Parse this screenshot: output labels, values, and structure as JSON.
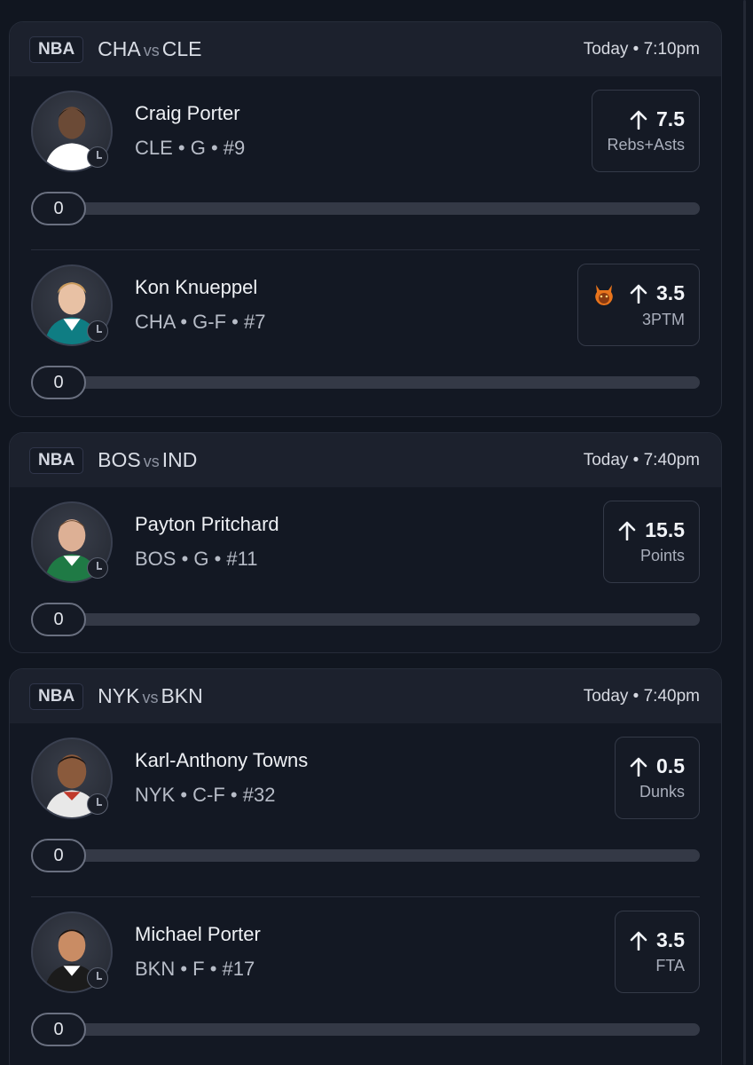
{
  "games": [
    {
      "league": "NBA",
      "home": "CHA",
      "vs": "vs",
      "away": "CLE",
      "time": "Today • 7:10pm",
      "players": [
        {
          "name": "Craig Porter",
          "meta": "CLE • G • #9",
          "line": "7.5",
          "stat": "Rebs+Asts",
          "progress": "0",
          "hot": false,
          "jersey": "#ffffff"
        },
        {
          "name": "Kon Knueppel",
          "meta": "CHA • G-F • #7",
          "line": "3.5",
          "stat": "3PTM",
          "progress": "0",
          "hot": true,
          "jersey": "#0f7d83"
        }
      ]
    },
    {
      "league": "NBA",
      "home": "BOS",
      "vs": "vs",
      "away": "IND",
      "time": "Today • 7:40pm",
      "players": [
        {
          "name": "Payton Pritchard",
          "meta": "BOS • G • #11",
          "line": "15.5",
          "stat": "Points",
          "progress": "0",
          "hot": false,
          "jersey": "#1f7a45"
        }
      ]
    },
    {
      "league": "NBA",
      "home": "NYK",
      "vs": "vs",
      "away": "BKN",
      "time": "Today • 7:40pm",
      "players": [
        {
          "name": "Karl-Anthony Towns",
          "meta": "NYK • C-F • #32",
          "line": "0.5",
          "stat": "Dunks",
          "progress": "0",
          "hot": false,
          "jersey": "#e8e8e8"
        },
        {
          "name": "Michael Porter",
          "meta": "BKN • F • #17",
          "line": "3.5",
          "stat": "FTA",
          "progress": "0",
          "hot": false,
          "jersey": "#1b1b1b"
        }
      ]
    }
  ],
  "colors": {
    "background": "#111620",
    "card": "#131823",
    "header": "#1c212d",
    "hot": "#e8741c"
  },
  "icons": [
    "arrow-up-icon",
    "clock-icon",
    "flame-devil-icon"
  ]
}
